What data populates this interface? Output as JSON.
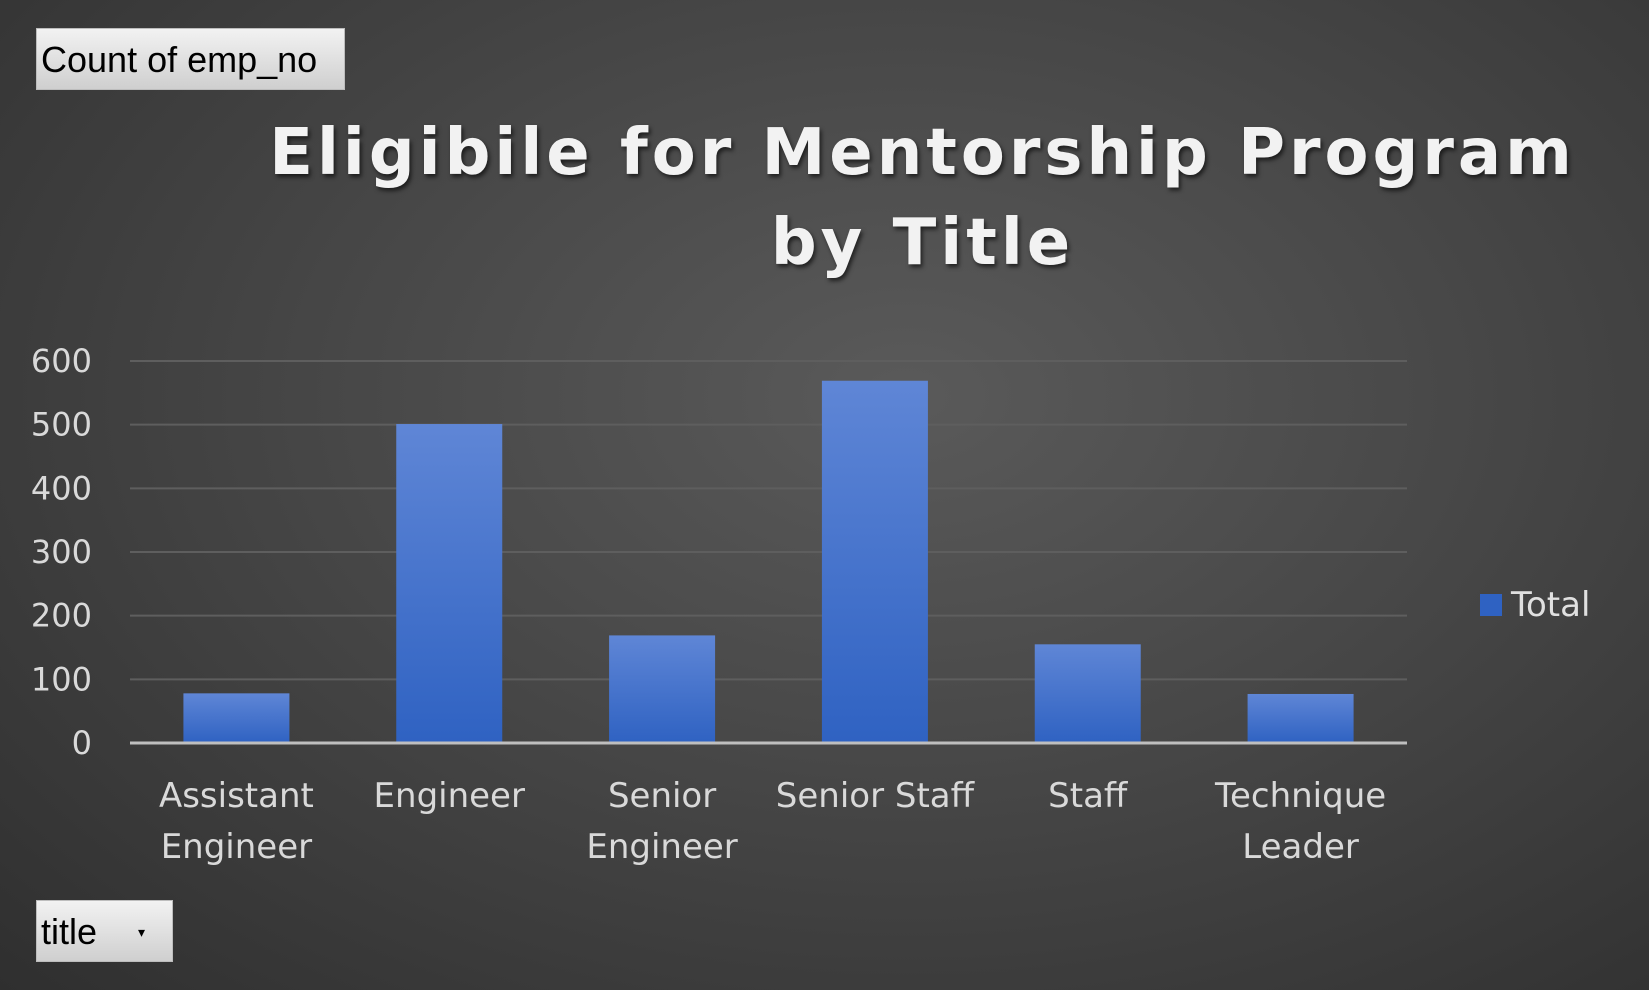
{
  "pivot": {
    "value_field_label": "Count of emp_no",
    "axis_field_label": "title"
  },
  "colors": {
    "bar_top": "#5f86d6",
    "bar_bottom": "#2f62c2",
    "gridline": "#5e5e5e",
    "axis_line": "#bfbfbf"
  },
  "chart_data": {
    "type": "bar",
    "title": "Eligibile for Mentorship Program by Title",
    "xlabel": "",
    "ylabel": "",
    "categories": [
      [
        "Assistant",
        "Engineer"
      ],
      [
        "Engineer"
      ],
      [
        "Senior",
        "Engineer"
      ],
      [
        "Senior Staff"
      ],
      [
        "Staff"
      ],
      [
        "Technique",
        "Leader"
      ]
    ],
    "series": [
      {
        "name": "Total",
        "values": [
          78,
          501,
          169,
          569,
          155,
          77
        ]
      }
    ],
    "ylim": [
      0,
      600
    ],
    "yticks": [
      0,
      100,
      200,
      300,
      400,
      500,
      600
    ],
    "grid": true,
    "legend_position": "right"
  }
}
